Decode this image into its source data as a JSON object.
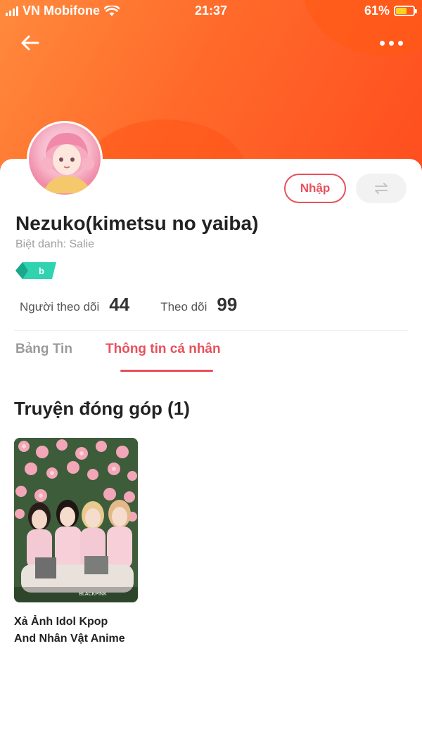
{
  "status": {
    "carrier": "VN Mobifone",
    "time": "21:37",
    "battery": "61%",
    "battery_level": 0.61
  },
  "header": {
    "back_icon": "arrow-left-icon",
    "more_icon": "more-dots-icon"
  },
  "profile": {
    "name": "Nezuko(kimetsu no yaiba)",
    "nickname_label": "Biệt danh: Salie",
    "badge_text": "b",
    "follow_label": "Nhập",
    "swap_icon": "swap-arrows-icon",
    "followers_label": "Người theo dõi",
    "followers_value": "44",
    "following_label": "Theo dõi",
    "following_value": "99"
  },
  "tabs": [
    {
      "label": "Bảng Tin",
      "active": false
    },
    {
      "label": "Thông tin cá nhân",
      "active": true
    }
  ],
  "contributions": {
    "title": "Truyện đóng góp (1)",
    "items": [
      {
        "title_line1": "Xả Ảnh Idol Kpop",
        "title_line2": "And Nhân Vật Anime",
        "cover_watermark": "BLACKPINK"
      }
    ]
  },
  "colors": {
    "accent": "#e8505b",
    "header_start": "#ff8a3d",
    "header_end": "#ff4d1f",
    "badge": "#2fd3b0"
  }
}
